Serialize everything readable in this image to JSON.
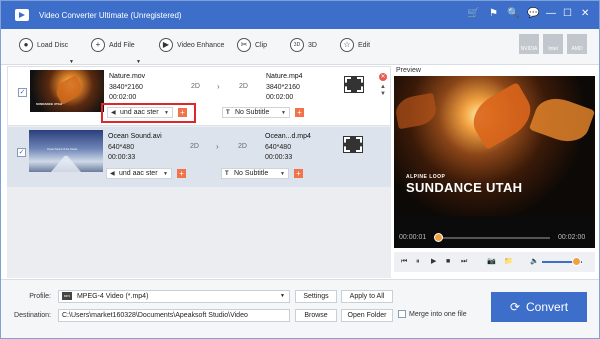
{
  "window": {
    "title": "Video Converter Ultimate (Unregistered)",
    "controls": [
      "🛒",
      "⚑",
      "🔍",
      "💬",
      "—",
      "☐",
      "✕"
    ]
  },
  "toolbar": {
    "load_disc": "Load Disc",
    "add_file": "Add File",
    "video_enhance": "Video Enhance",
    "clip": "Clip",
    "three_d": "3D",
    "three_d_icon": "3D",
    "edit": "Edit",
    "hw_labels": [
      "NVIDIA",
      "Intel",
      "AMD"
    ]
  },
  "files": [
    {
      "name": "Nature.mov",
      "resolution": "3840*2160",
      "duration": "00:02:00",
      "mode_in": "2D",
      "mode_out": "2D",
      "output_name": "Nature.mp4",
      "output_resolution": "3840*2160",
      "output_duration": "00:02:00",
      "audio": "und aac ster",
      "subtitle": "No Subtitle",
      "thumb_caption": "SUNDANCE UTAH",
      "checked": true
    },
    {
      "name": "Ocean Sound.avi",
      "resolution": "640*480",
      "duration": "00:00:33",
      "mode_in": "2D",
      "mode_out": "2D",
      "output_name": "Ocean...d.mp4",
      "output_resolution": "640*480",
      "output_duration": "00:00:33",
      "audio": "und aac ster",
      "subtitle": "No Subtitle",
      "thumb_caption": "Ocean Sound of the Ocean",
      "checked": true
    }
  ],
  "preview": {
    "label": "Preview",
    "subtitle_small": "ALPINE LOOP",
    "title_big": "SUNDANCE UTAH",
    "time_current": "00:00:01",
    "time_total": "00:02:00",
    "progress_fraction": 0.02,
    "volume_fraction": 0.85
  },
  "bottom": {
    "profile_label": "Profile:",
    "profile_value": "MPEG-4 Video (*.mp4)",
    "settings": "Settings",
    "apply_to_all": "Apply to All",
    "destination_label": "Destination:",
    "destination_value": "C:\\Users\\market160328\\Documents\\Apeaksoft Studio\\Video",
    "browse": "Browse",
    "open_folder": "Open Folder",
    "merge_label": "Merge into one file",
    "convert": "Convert"
  }
}
